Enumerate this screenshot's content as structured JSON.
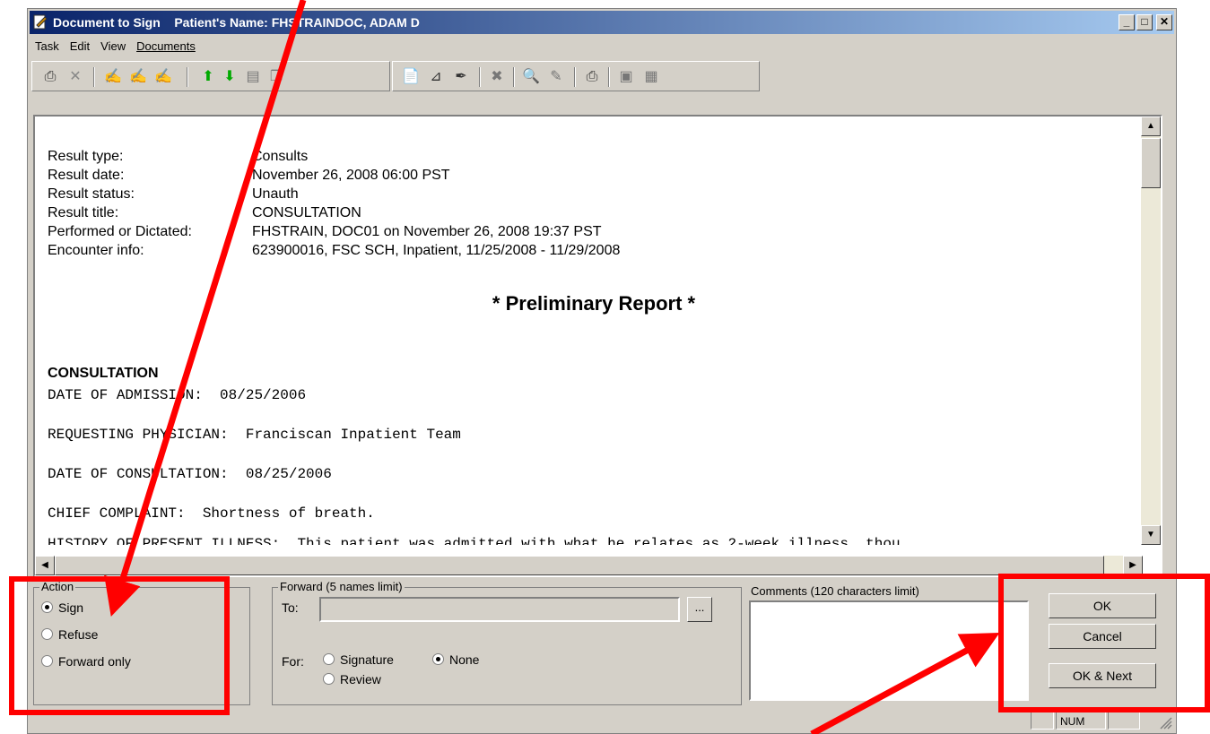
{
  "window": {
    "title": "Document to Sign    Patient's Name: FHSTRAINDOC, ADAM D",
    "minimize": "_",
    "maximize": "□",
    "close": "✕"
  },
  "menu": [
    "Task",
    "Edit",
    "View",
    "Documents"
  ],
  "toolbar": {
    "icons": [
      "printer-icon",
      "close-x-icon",
      "sign-1-icon",
      "sign-2-icon",
      "sign-3-icon",
      "arrow-up-icon",
      "arrow-down-icon",
      "document-icon",
      "copy-icon",
      "new-note-icon",
      "ruler-icon",
      "signature-pen-icon",
      "delete-icon",
      "review-icon",
      "wand-icon",
      "print-icon",
      "monitor-icon",
      "stack-icon"
    ]
  },
  "document": {
    "header_rows": [
      {
        "label": "Result type:",
        "value": "Consults"
      },
      {
        "label": "Result date:",
        "value": "November 26, 2008 06:00 PST"
      },
      {
        "label": "Result status:",
        "value": "Unauth"
      },
      {
        "label": "Result title:",
        "value": "CONSULTATION"
      },
      {
        "label": "Performed or Dictated:",
        "value": "FHSTRAIN, DOC01 on November 26, 2008 19:37 PST"
      },
      {
        "label": "Encounter info:",
        "value": "623900016, FSC SCH, Inpatient, 11/25/2008 - 11/29/2008"
      }
    ],
    "prelim": "* Preliminary Report *",
    "consult_heading": "CONSULTATION",
    "lines": [
      "DATE OF ADMISSION:  08/25/2006",
      "REQUESTING PHYSICIAN:  Franciscan Inpatient Team",
      "DATE OF CONSULTATION:  08/25/2006",
      "CHIEF COMPLAINT:  Shortness of breath.",
      "HISTORY OF PRESENT ILLNESS:  This patient was admitted with what he relates as 2-week illness, thou"
    ]
  },
  "action": {
    "label": "Action",
    "options": [
      "Sign",
      "Refuse",
      "Forward only"
    ],
    "selected": "Sign"
  },
  "forward": {
    "label": "Forward (5 names limit)",
    "to_label": "To:",
    "to_value": "",
    "browse": "...",
    "for_label": "For:",
    "options": [
      "Signature",
      "None",
      "Review"
    ],
    "selected": "None"
  },
  "comments": {
    "label": "Comments (120 characters limit)",
    "value": ""
  },
  "buttons": {
    "ok": "OK",
    "cancel": "Cancel",
    "ok_next": "OK & Next"
  },
  "status": {
    "num": "NUM"
  },
  "colors": {
    "annotation": "#ff0000",
    "title_bar": "#0a246a",
    "window_bg": "#d4d0c8"
  }
}
